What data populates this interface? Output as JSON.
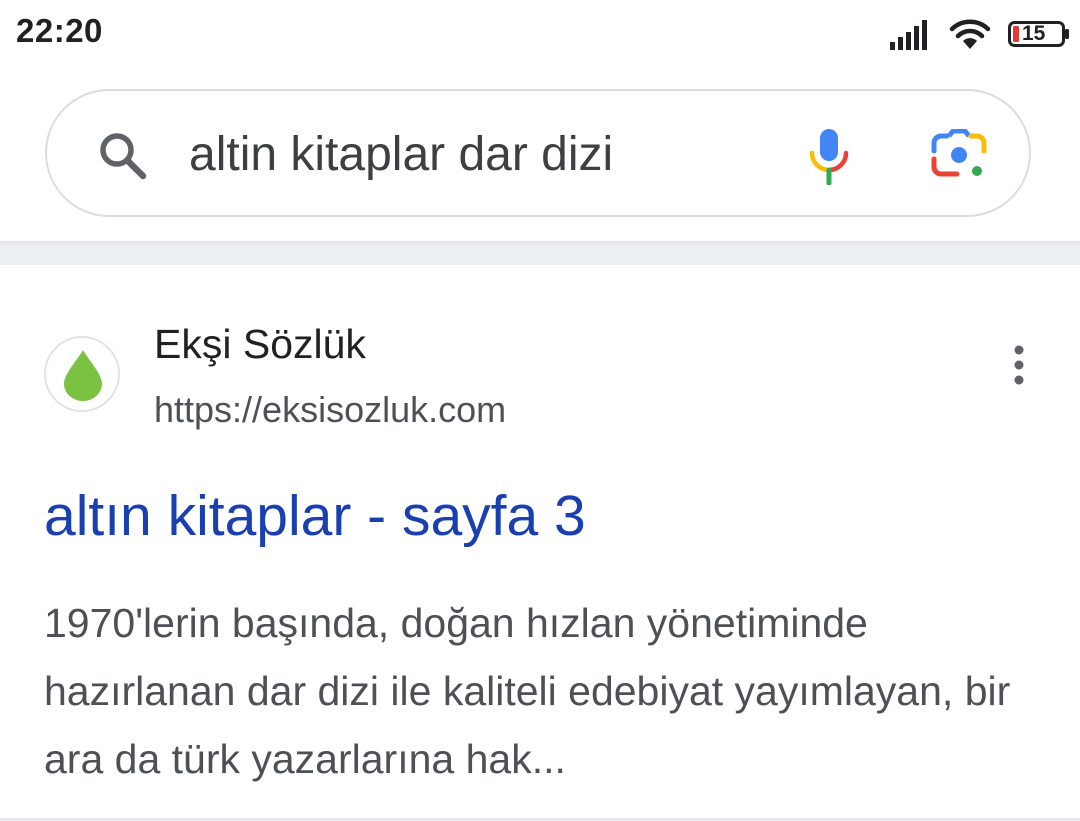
{
  "status_bar": {
    "time": "22:20",
    "battery_level": "15",
    "icons": [
      "signal-icon",
      "wifi-icon",
      "battery-icon"
    ]
  },
  "search": {
    "query": "altin kitaplar dar dizi",
    "icons": [
      "search-icon",
      "mic-icon",
      "google-lens-icon"
    ]
  },
  "result": {
    "site_name": "Ekşi Sözlük",
    "site_url": "https://eksisozluk.com",
    "title": "altın kitaplar - sayfa 3",
    "snippet": "1970'lerin başında, doğan hızlan yönetiminde hazırlanan dar dizi ile kaliteli edebiyat yayımlayan, bir ara da türk yazarlarına hak...",
    "icons": [
      "eksi-drop-icon",
      "more-vert-icon"
    ]
  },
  "colors": {
    "link_blue": "#1a3fb1",
    "favicon_green": "#7bc142",
    "battery_red": "#e53935",
    "google_blue": "#4285f4",
    "google_red": "#ea4335",
    "google_yellow": "#fbbc05",
    "google_green": "#34a853"
  }
}
